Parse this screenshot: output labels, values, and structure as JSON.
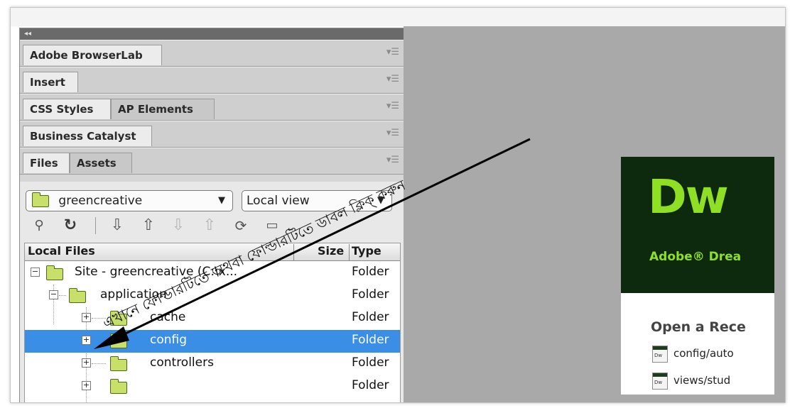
{
  "panel": {
    "collapse_label": "◂◂",
    "groups": [
      {
        "tabs": [
          "Adobe BrowserLab"
        ]
      },
      {
        "tabs": [
          "Insert"
        ]
      },
      {
        "tabs": [
          "CSS Styles",
          "AP Elements"
        ]
      },
      {
        "tabs": [
          "Business Catalyst"
        ]
      },
      {
        "tabs": [
          "Files",
          "Assets"
        ]
      }
    ],
    "options_icon": "panel-options-icon"
  },
  "files": {
    "site_dropdown": "greencreative",
    "view_dropdown": "Local view",
    "toolbar_icons": [
      "connect-icon",
      "refresh-icon",
      "get-icon",
      "put-icon",
      "check-out-icon",
      "check-in-icon",
      "sync-icon",
      "expand-icon"
    ],
    "columns": {
      "name": "Local Files",
      "size": "Size",
      "type": "Type"
    },
    "rows": [
      {
        "name": "Site - greencreative (C:\\x...",
        "type": "Folder",
        "expander": "⊟"
      },
      {
        "name": "application",
        "type": "Folder",
        "expander": "⊟"
      },
      {
        "name": "cache",
        "type": "Folder",
        "expander": "+"
      },
      {
        "name": "config",
        "type": "Folder",
        "expander": "+"
      },
      {
        "name": "controllers",
        "type": "Folder",
        "expander": "+"
      },
      {
        "name": "",
        "type": "Folder",
        "expander": "+"
      }
    ]
  },
  "welcome": {
    "logo": "Dw",
    "product_name": "Adobe® Drea",
    "open_recent": "Open a Rece",
    "recent_items": [
      "config/auto",
      "views/stud"
    ]
  },
  "annotation": {
    "text": "এখানে ফোল্ডারটিতে অথবা ফোল্ডারটিতে ডাবল ক্লিক্ করুন"
  },
  "colors": {
    "selection": "#3a8ee6",
    "dw_green": "#8fe024",
    "dw_dark": "#0d2a0f"
  }
}
